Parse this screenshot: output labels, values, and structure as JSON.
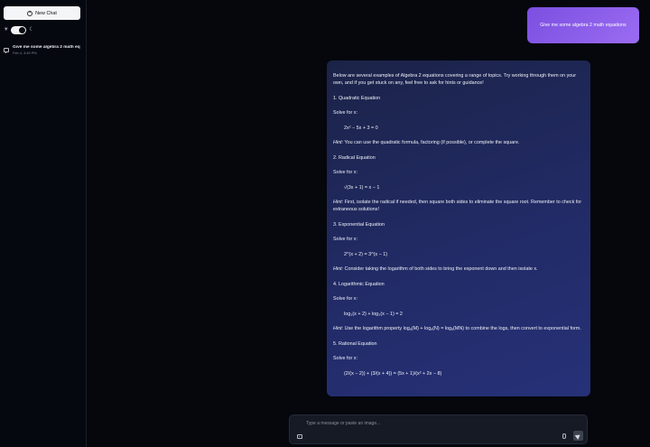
{
  "sidebar": {
    "new_chat_label": "New Chat",
    "history": [
      {
        "title": "Give me some algebra 2 math eq",
        "date": "Feb 4, 3:49 PM"
      }
    ]
  },
  "conversation": {
    "user_message": "Give me some algebra 2 math equations",
    "assistant": {
      "intro": "Below are several examples of Algebra 2 equations covering a range of topics. Try working through them on your own, and if you get stuck on any, feel free to ask for hints or guidance!",
      "s1_title": "1. Quadratic Equation",
      "s1_prompt": "Solve for x:",
      "s1_eq": "2x² − 5x + 3 = 0",
      "s1_hint_label": "Hint:",
      "s1_hint": " You can use the quadratic formula, factoring (if possible), or complete the square.",
      "s2_title": "2. Radical Equation",
      "s2_prompt": "Solve for x:",
      "s2_eq": "√(3x + 1) = x − 1",
      "s2_hint_label": "Hint:",
      "s2_hint": " First, isolate the radical if needed, then square both sides to eliminate the square root. Remember to check for extraneous solutions!",
      "s3_title": "3. Exponential Equation",
      "s3_prompt": "Solve for x:",
      "s3_eq": "2^(x + 2) = 3^(x − 1)",
      "s3_hint_label": "Hint:",
      "s3_hint": " Consider taking the logarithm of both sides to bring the exponent down and then isolate x.",
      "s4_title": "4. Logarithmic Equation",
      "s4_prompt": "Solve for x:",
      "s4_eq": "log₃(x + 2) + log₃(x − 1) = 2",
      "s4_hint_label": "Hint:",
      "s4_hint": " Use the logarithm property logₐ(M) + logₐ(N) = logₐ(MN) to combine the logs, then convert to exponential form.",
      "s5_title": "5. Rational Equation",
      "s5_prompt": "Solve for x:",
      "s5_eq": "(2/(x − 2)) + (3/(x + 4)) = (5x + 1)/(x² + 2x − 8)"
    }
  },
  "composer": {
    "placeholder": "Type a message or paste an image..."
  },
  "icons": {
    "new_chat": "plus-circle-icon",
    "theme_light": "sun-icon",
    "theme_dark": "moon-icon",
    "chat": "chat-bubble-icon",
    "attach": "image-icon",
    "voice": "microphone-icon",
    "send": "send-icon"
  },
  "colors": {
    "background": "#05070d",
    "user_bubble": "#8b5cf6",
    "assistant_bubble": "#222b66",
    "composer": "#161a24"
  }
}
